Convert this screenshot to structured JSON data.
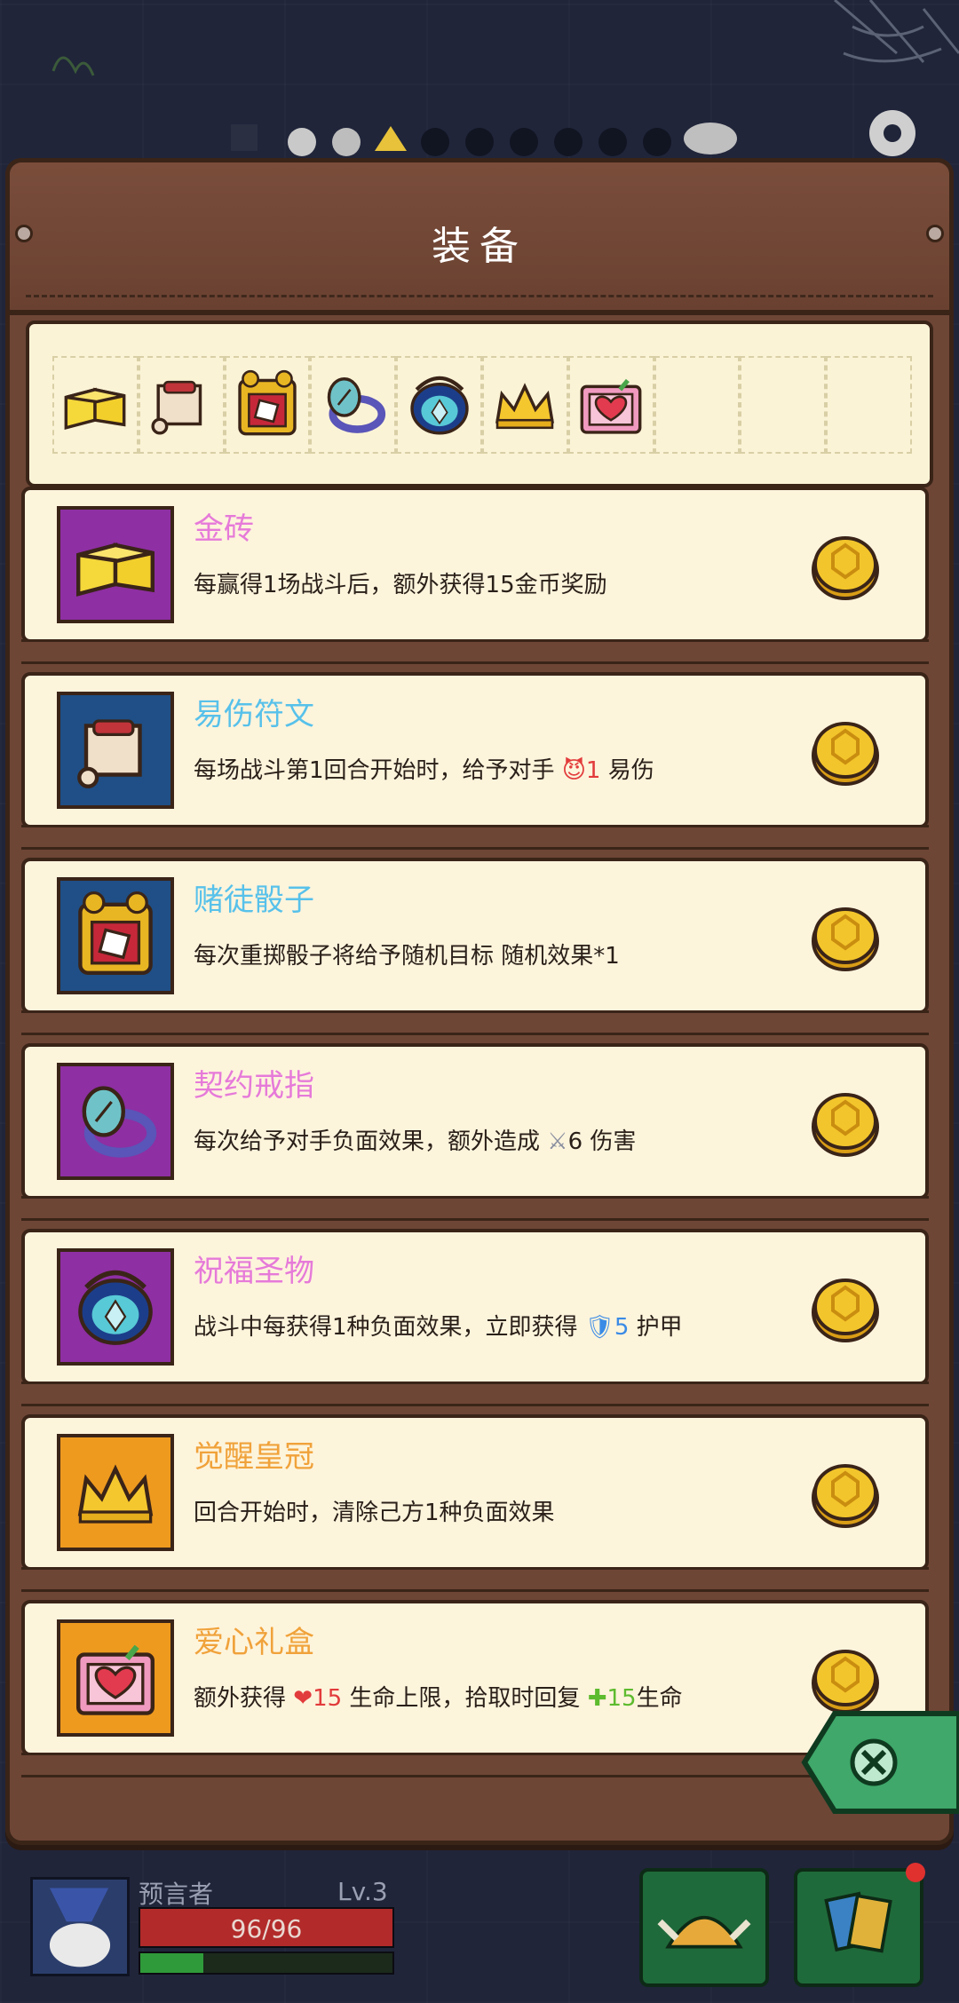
{
  "panel": {
    "title": "装备"
  },
  "slots": [
    {
      "icon": "gold-brick-icon",
      "filled": true
    },
    {
      "icon": "scroll-icon",
      "filled": true
    },
    {
      "icon": "dice-icon",
      "filled": true
    },
    {
      "icon": "ring-icon",
      "filled": true
    },
    {
      "icon": "relic-icon",
      "filled": true
    },
    {
      "icon": "crown-icon",
      "filled": true
    },
    {
      "icon": "heart-box-icon",
      "filled": true
    },
    {
      "icon": "",
      "filled": false
    },
    {
      "icon": "",
      "filled": false
    },
    {
      "icon": "",
      "filled": false
    }
  ],
  "items": [
    {
      "name": "金砖",
      "name_color": "#e67ad9",
      "bg": "#8e2fa3",
      "desc_parts": [
        "每赢得1场战斗后，额外获得15金币奖励"
      ]
    },
    {
      "name": "易伤符文",
      "name_color": "#57c1ea",
      "bg": "#1f4f86",
      "desc_parts": [
        "每场战斗第1回合开始时，给予对手 ",
        "1",
        " 易伤"
      ]
    },
    {
      "name": "赌徒骰子",
      "name_color": "#57c1ea",
      "bg": "#1f4f86",
      "desc_parts": [
        "每次重掷骰子将给予随机目标 随机效果*1"
      ]
    },
    {
      "name": "契约戒指",
      "name_color": "#e67ad9",
      "bg": "#8e2fa3",
      "desc_parts": [
        "每次给予对手负面效果，额外造成 ",
        "6",
        " 伤害"
      ]
    },
    {
      "name": "祝福圣物",
      "name_color": "#e67ad9",
      "bg": "#8e2fa3",
      "desc_parts": [
        "战斗中每获得1种负面效果，立即获得 ",
        "5",
        " 护甲"
      ]
    },
    {
      "name": "觉醒皇冠",
      "name_color": "#f0a23a",
      "bg": "#ee9a1f",
      "desc_parts": [
        "回合开始时，清除己方1种负面效果"
      ]
    },
    {
      "name": "爱心礼盒",
      "name_color": "#f0a23a",
      "bg": "#ee9a1f",
      "desc_parts": [
        "额外获得 ",
        "15",
        " 生命上限，拾取时回复 ",
        "15",
        "生命"
      ]
    }
  ],
  "player": {
    "name": "预言者",
    "level": "Lv.3",
    "hp": "96/96",
    "hp_fraction": 1.0,
    "xp_fraction": 0.25
  }
}
